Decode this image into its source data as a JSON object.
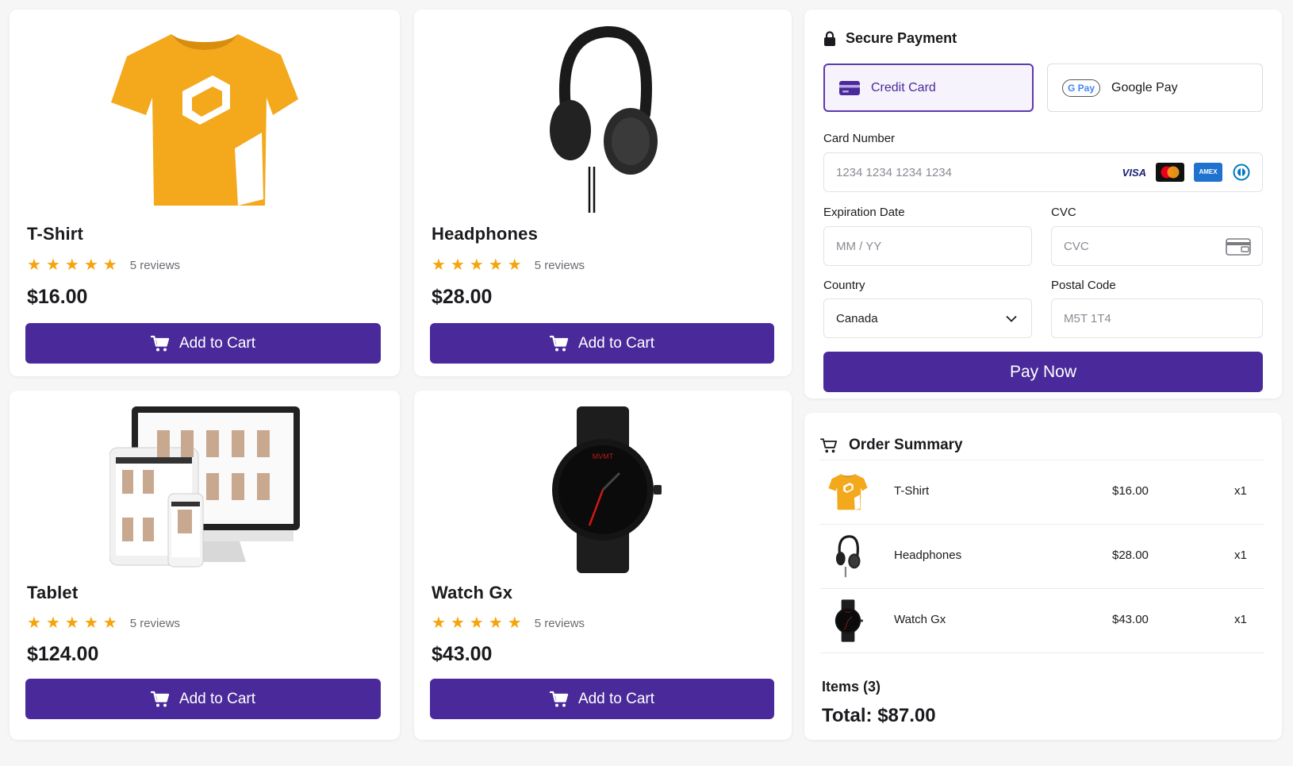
{
  "colors": {
    "accent": "#4a2a9a",
    "star": "#f5a40b",
    "tshirt": "#f4a81c"
  },
  "products": [
    {
      "name": "T-Shirt",
      "stars": 5,
      "reviews": "5 reviews",
      "price": "$16.00",
      "button": "Add to Cart",
      "image_icon": "tshirt-image"
    },
    {
      "name": "Headphones",
      "stars": 5,
      "reviews": "5 reviews",
      "price": "$28.00",
      "button": "Add to Cart",
      "image_icon": "headphones-image"
    },
    {
      "name": "Tablet",
      "stars": 5,
      "reviews": "5 reviews",
      "price": "$124.00",
      "button": "Add to Cart",
      "image_icon": "devices-image"
    },
    {
      "name": "Watch Gx",
      "stars": 5,
      "reviews": "5 reviews",
      "price": "$43.00",
      "button": "Add to Cart",
      "image_icon": "watch-image"
    }
  ],
  "payment": {
    "title": "Secure Payment",
    "methods": [
      "Credit Card",
      "Google Pay"
    ],
    "gpay_badge": "G Pay",
    "card_number_label": "Card Number",
    "card_number_placeholder": "1234 1234 1234 1234",
    "card_brands": [
      "VISA",
      "mastercard",
      "AMEX",
      "diners"
    ],
    "expiration_label": "Expiration Date",
    "expiration_placeholder": "MM / YY",
    "cvc_label": "CVC",
    "cvc_placeholder": "CVC",
    "country_label": "Country",
    "country_value": "Canada",
    "postal_label": "Postal Code",
    "postal_placeholder": "M5T 1T4",
    "pay_button": "Pay Now"
  },
  "summary": {
    "title": "Order Summary",
    "items": [
      {
        "name": "T-Shirt",
        "price": "$16.00",
        "qty": "x1"
      },
      {
        "name": "Headphones",
        "price": "$28.00",
        "qty": "x1"
      },
      {
        "name": "Watch Gx",
        "price": "$43.00",
        "qty": "x1"
      }
    ],
    "items_count": "Items (3)",
    "total": "Total: $87.00"
  }
}
